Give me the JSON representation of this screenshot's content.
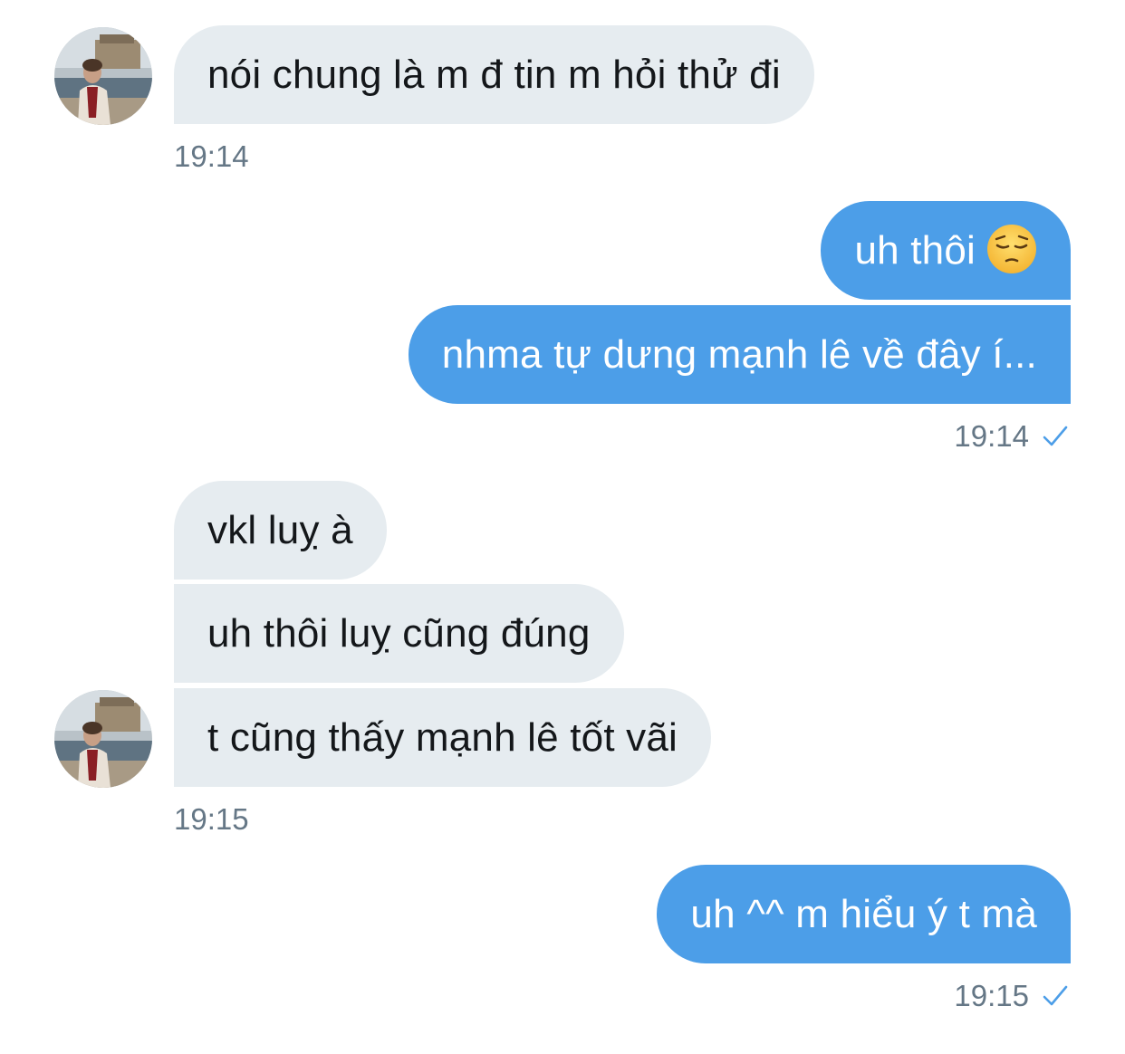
{
  "conversation": {
    "messages": [
      {
        "text": "nói chung là m đ tin m hỏi thử đi"
      },
      {
        "text": "uh thôi",
        "emoji": "pensive-face"
      },
      {
        "text": "nhma tự dưng mạnh lê về đây í..."
      },
      {
        "text": "vkl luỵ à"
      },
      {
        "text": "uh thôi luỵ cũng đúng"
      },
      {
        "text": "t cũng thấy mạnh lê tốt vãi"
      },
      {
        "text": "uh ^^ m hiểu ý t mà"
      }
    ],
    "timestamps": [
      "19:14",
      "19:14",
      "19:15",
      "19:15"
    ]
  },
  "colors": {
    "incoming_bubble": "#e6ecf0",
    "outgoing_bubble": "#4c9ee8",
    "timestamp_text": "#657786",
    "read_check": "#4c9ee8"
  },
  "icons": {
    "read_receipt": "checkmark-icon",
    "avatar": "user-avatar-photo"
  }
}
